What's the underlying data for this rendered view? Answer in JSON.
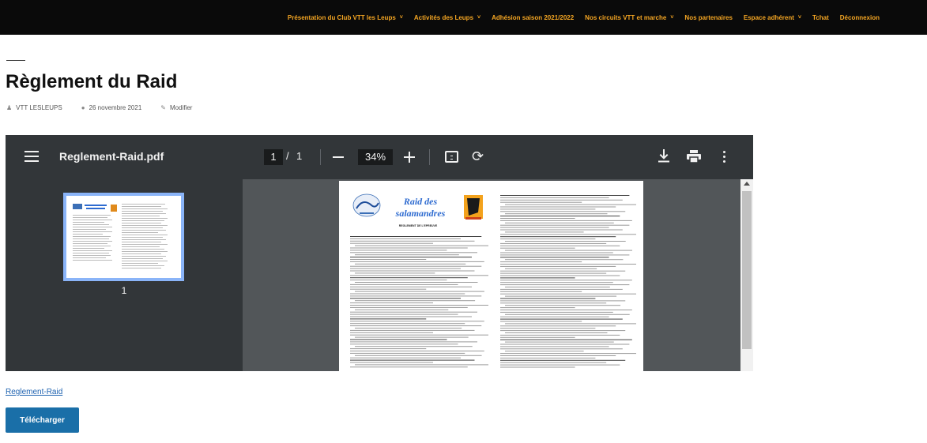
{
  "nav": {
    "items": [
      {
        "label": "Présentation du Club VTT les Leups",
        "dropdown": true
      },
      {
        "label": "Activités des Leups",
        "dropdown": true
      },
      {
        "label": "Adhésion saison 2021/2022",
        "dropdown": false
      },
      {
        "label": "Nos circuits VTT et marche",
        "dropdown": true
      },
      {
        "label": "Nos partenaires",
        "dropdown": false
      },
      {
        "label": "Espace adhérent",
        "dropdown": true
      },
      {
        "label": "Tchat",
        "dropdown": false
      },
      {
        "label": "Déconnexion",
        "dropdown": false
      }
    ],
    "accent_color": "#f5a623"
  },
  "article": {
    "title": "Règlement du Raid",
    "author": "VTT LESLEUPS",
    "date": "26 novembre 2021",
    "edit_label": "Modifier"
  },
  "pdf_viewer": {
    "filename": "Reglement-Raid.pdf",
    "current_page": "1",
    "page_separator": "/",
    "total_pages": "1",
    "zoom": "34%",
    "thumbnail_label": "1",
    "doc_title_1": "Raid des",
    "doc_title_2": "salamandres",
    "doc_subtitle": "REGLEMENT DE L'EPREUVE"
  },
  "file_link": "Reglement-Raid",
  "download_button": "Télécharger"
}
